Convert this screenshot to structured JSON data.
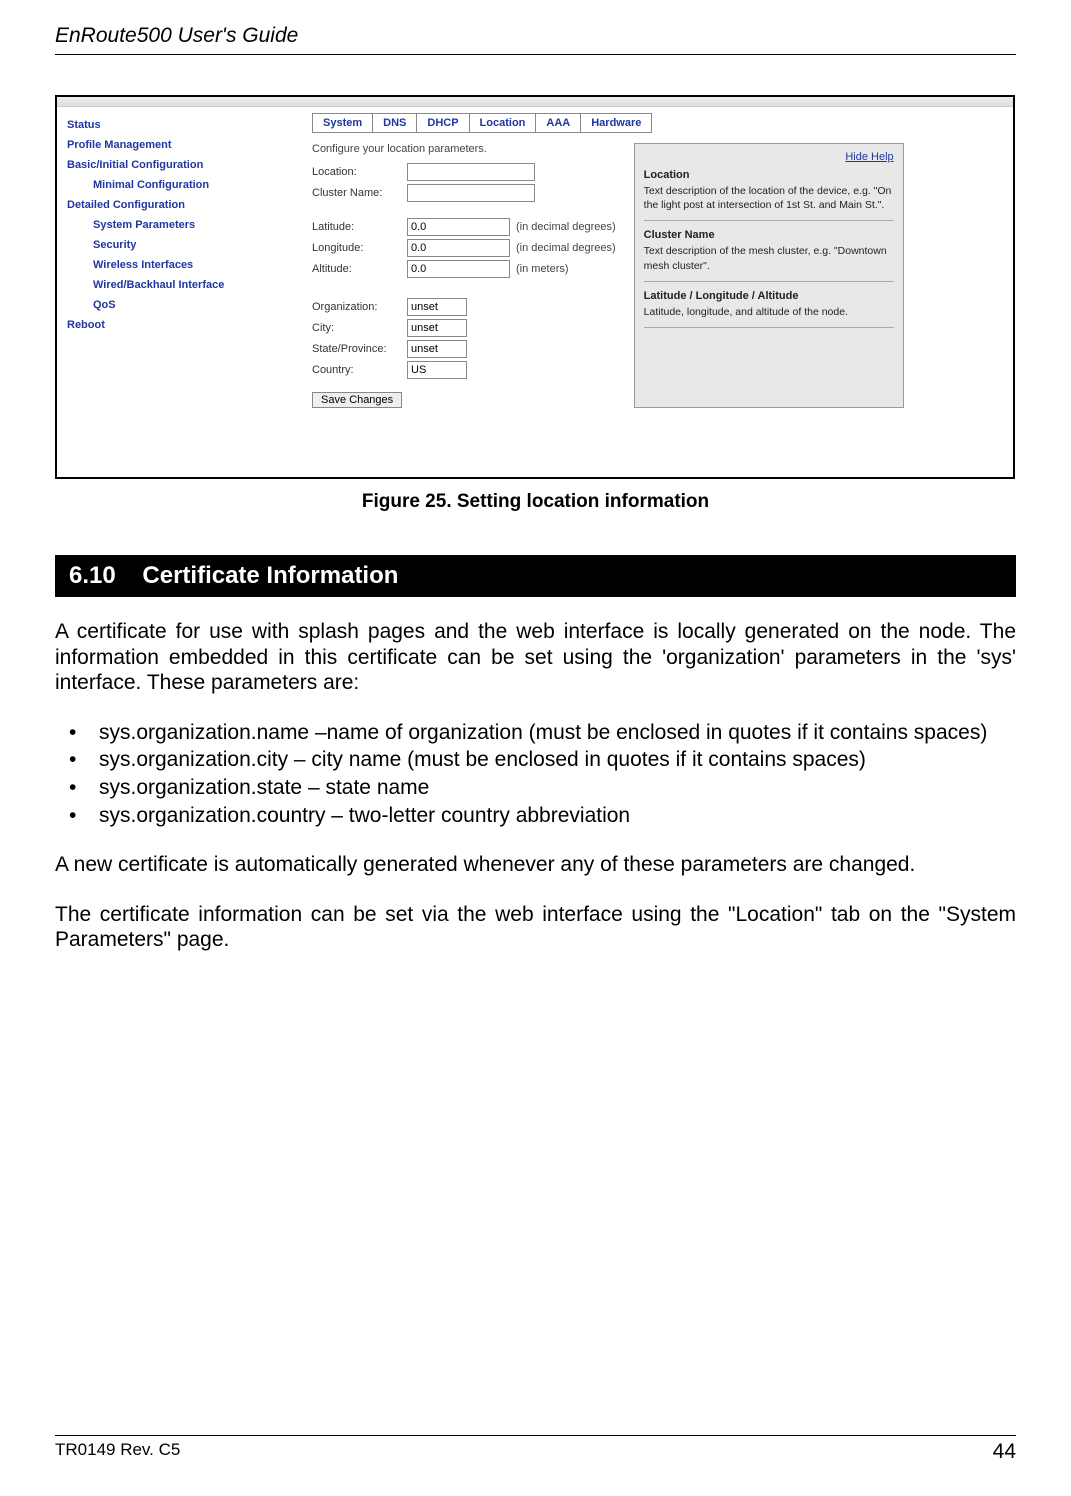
{
  "header_title": "EnRoute500 User's Guide",
  "sidebar": {
    "items": [
      {
        "label": "Status",
        "sub": false
      },
      {
        "label": "Profile Management",
        "sub": false
      },
      {
        "label": "Basic/Initial Configuration",
        "sub": false
      },
      {
        "label": "Minimal Configuration",
        "sub": true
      },
      {
        "label": "Detailed Configuration",
        "sub": false
      },
      {
        "label": "System Parameters",
        "sub": true
      },
      {
        "label": "Security",
        "sub": true
      },
      {
        "label": "Wireless Interfaces",
        "sub": true
      },
      {
        "label": "Wired/Backhaul Interface",
        "sub": true
      },
      {
        "label": "QoS",
        "sub": true
      },
      {
        "label": "Reboot",
        "sub": false
      }
    ]
  },
  "tabs": [
    {
      "label": "System"
    },
    {
      "label": "DNS"
    },
    {
      "label": "DHCP"
    },
    {
      "label": "Location"
    },
    {
      "label": "AAA"
    },
    {
      "label": "Hardware"
    }
  ],
  "form": {
    "desc": "Configure your location parameters.",
    "location_label": "Location:",
    "cluster_label": "Cluster Name:",
    "latitude_label": "Latitude:",
    "latitude_val": "0.0",
    "latitude_unit": "(in decimal degrees)",
    "longitude_label": "Longitude:",
    "longitude_val": "0.0",
    "longitude_unit": "(in decimal degrees)",
    "altitude_label": "Altitude:",
    "altitude_val": "0.0",
    "altitude_unit": "(in meters)",
    "organization_label": "Organization:",
    "organization_val": "unset",
    "city_label": "City:",
    "city_val": "unset",
    "state_label": "State/Province:",
    "state_val": "unset",
    "country_label": "Country:",
    "country_val": "US",
    "save_label": "Save Changes"
  },
  "help": {
    "hide": "Hide Help",
    "h1": "Location",
    "t1": "Text description of the location of the device, e.g. \"On the light post at intersection of 1st St. and Main St.\".",
    "h2": "Cluster Name",
    "t2": "Text description of the mesh cluster, e.g. \"Downtown mesh cluster\".",
    "h3": "Latitude / Longitude / Altitude",
    "t3": "Latitude, longitude, and altitude of the node."
  },
  "figure_caption": "Figure 25. Setting location information",
  "section": {
    "num": "6.10",
    "title": "Certificate Information"
  },
  "body": {
    "p1": "A certificate for use with splash pages and the web interface is locally generated on the node. The information embedded in this certificate can be set using the 'organization' parameters in the 'sys' interface. These parameters are:",
    "bul": [
      "sys.organization.name –name of organization (must be enclosed in quotes if it contains spaces)",
      "sys.organization.city – city name (must be enclosed in quotes if it contains spaces)",
      "sys.organization.state – state name",
      "sys.organization.country – two-letter country abbreviation"
    ],
    "p2": "A new certificate is automatically generated whenever any of these parameters are changed.",
    "p3": "The certificate information can be set via the web interface using the \"Location\" tab on the \"System Parameters\" page."
  },
  "footer": {
    "left": "TR0149 Rev. C5",
    "right": "44"
  }
}
